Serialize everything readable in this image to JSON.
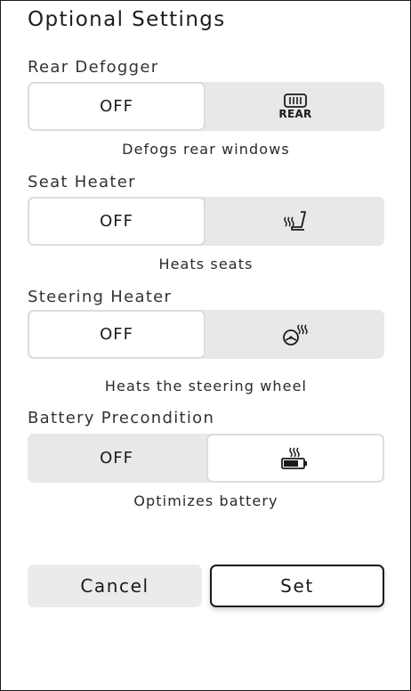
{
  "dialog": {
    "title": "Optional Settings"
  },
  "settings": [
    {
      "label": "Rear Defogger",
      "off_label": "OFF",
      "on_icon": "rear-defogger-icon",
      "on_icon_text": "REAR",
      "selected": "off",
      "description": "Defogs rear windows"
    },
    {
      "label": "Seat Heater",
      "off_label": "OFF",
      "on_icon": "seat-heater-icon",
      "selected": "off",
      "description": "Heats seats"
    },
    {
      "label": "Steering Heater",
      "off_label": "OFF",
      "on_icon": "steering-heater-icon",
      "selected": "off",
      "description": "Heats the steering wheel"
    },
    {
      "label": "Battery Precondition",
      "off_label": "OFF",
      "on_icon": "battery-heater-icon",
      "selected": "on",
      "description": "Optimizes battery"
    }
  ],
  "actions": {
    "cancel_label": "Cancel",
    "set_label": "Set"
  },
  "colors": {
    "segment_track": "#e8e8e8",
    "segment_selected": "#ffffff",
    "text": "#1a1a1a"
  }
}
